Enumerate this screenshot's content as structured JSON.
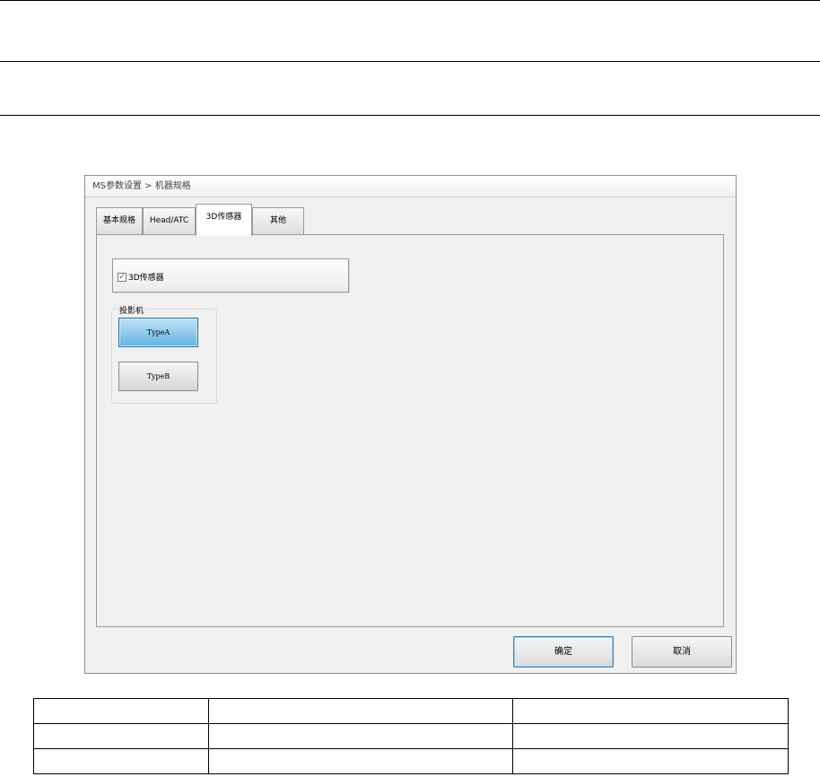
{
  "window": {
    "title": "MS参数设置 > 机器规格"
  },
  "tabs": [
    {
      "label": "基本规格",
      "active": false
    },
    {
      "label": "Head/ATC",
      "active": false
    },
    {
      "label": "3D传感器",
      "active": true
    },
    {
      "label": "其他",
      "active": false
    }
  ],
  "sensor": {
    "label": "3D传感器",
    "checked": true
  },
  "projector": {
    "group_label": "投影机",
    "type_a_label": "TypeA",
    "type_b_label": "TypeB",
    "selected": "TypeA"
  },
  "buttons": {
    "ok_label": "确定",
    "cancel_label": "取消"
  },
  "colors": {
    "selected_button": "#62b3e4",
    "window_bg": "#f0f0f0"
  }
}
